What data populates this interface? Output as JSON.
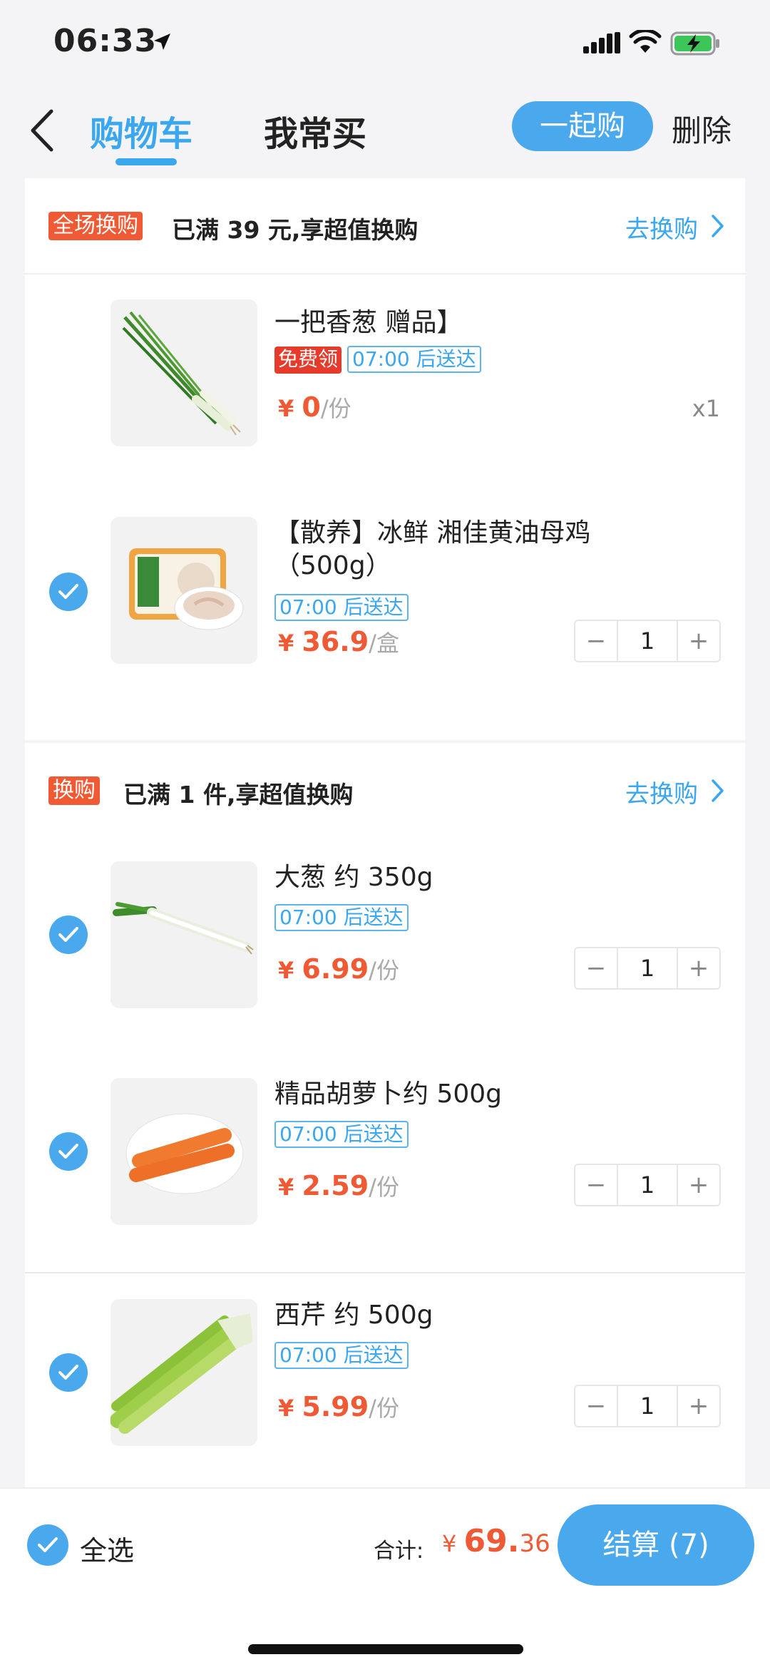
{
  "status": {
    "time": "06:33"
  },
  "header": {
    "tab_cart": "购物车",
    "tab_often": "我常买",
    "group_buy": "一起购",
    "delete": "删除"
  },
  "promo1": {
    "tag": "全场换购",
    "text": "已满 39 元,享超值换购",
    "link": "去换购"
  },
  "promo2": {
    "tag": "换购",
    "text": "已满 1 件,享超值换购",
    "link": "去换购"
  },
  "items": [
    {
      "name": "一把香葱 赠品】",
      "tag_free": "免费领",
      "delivery": "07:00 后送达",
      "yen": "¥ ",
      "price": "0",
      "unit": "/份",
      "qty_text": "x1"
    },
    {
      "name": "【散养】冰鲜 湘佳黄油母鸡（500g）",
      "delivery": "07:00 后送达",
      "yen": "¥ ",
      "price": "36.9",
      "unit": "/盒",
      "qty": "1"
    },
    {
      "name": "大葱 约 350g",
      "delivery": "07:00 后送达",
      "yen": "¥ ",
      "price": "6.99",
      "unit": "/份",
      "qty": "1"
    },
    {
      "name": "精品胡萝卜约 500g",
      "delivery": "07:00 后送达",
      "yen": "¥ ",
      "price": "2.59",
      "unit": "/份",
      "qty": "1"
    },
    {
      "name": "西芹 约 500g",
      "delivery": "07:00 后送达",
      "yen": "¥ ",
      "price": "5.99",
      "unit": "/份",
      "qty": "1"
    }
  ],
  "stepper": {
    "minus": "−",
    "plus": "+"
  },
  "footer": {
    "select_all": "全选",
    "total_label": "合计:",
    "total_yen": "¥ ",
    "total_int": "69.",
    "total_dec": "36",
    "checkout": "结算 (7)"
  },
  "colors": {
    "accent": "#3aa7ee",
    "price": "#ef5a35",
    "free_tag": "#e63a2a"
  }
}
